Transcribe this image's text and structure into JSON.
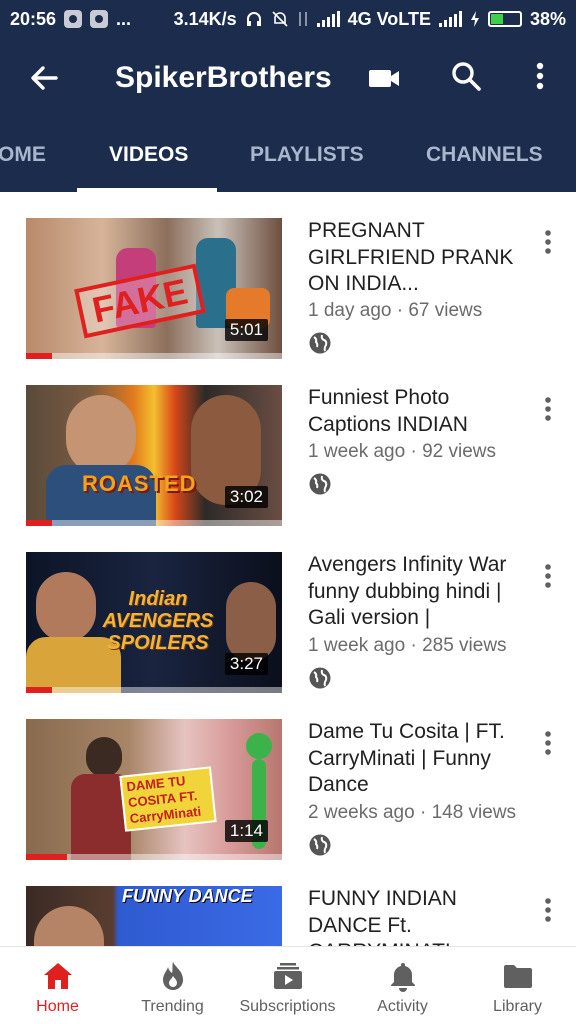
{
  "status_bar": {
    "time": "20:56",
    "dots": "...",
    "speed": "3.14K/s",
    "network": "4G VoLTE",
    "battery": "38%"
  },
  "appbar": {
    "title": "SpikerBrothers",
    "back_icon": "back-arrow-icon",
    "camera_icon": "video-camera-icon",
    "search_icon": "search-icon",
    "more_icon": "more-vert-icon"
  },
  "tabs": [
    {
      "label": "OME",
      "active": false
    },
    {
      "label": "VIDEOS",
      "active": true
    },
    {
      "label": "PLAYLISTS",
      "active": false
    },
    {
      "label": "CHANNELS",
      "active": false
    }
  ],
  "videos": [
    {
      "title": "PREGNANT GIRLFRIEND PRANK ON INDIA...",
      "meta": "1 day ago · 67 views",
      "duration": "5:01",
      "overlay": "FAKE",
      "watched_fraction": 0.1
    },
    {
      "title": "Funniest Photo Captions INDIAN",
      "meta": "1 week ago · 92 views",
      "duration": "3:02",
      "overlay": "ROASTED",
      "watched_fraction": 0.1
    },
    {
      "title": "Avengers Infinity War funny dubbing hindi | Gali version |",
      "meta": "1 week ago · 285 views",
      "duration": "3:27",
      "overlay": "Indian AVENGERS SPOILERS",
      "watched_fraction": 0.1
    },
    {
      "title": "Dame Tu Cosita | FT. CarryMinati | Funny Dance",
      "meta": "2 weeks ago · 148 views",
      "duration": "1:14",
      "overlay": "DAME TU COSITA FT. CarryMinati",
      "watched_fraction": 0.16
    },
    {
      "title": "FUNNY INDIAN DANCE Ft. CARRYMINATI",
      "meta": "",
      "duration": "",
      "overlay": "FUNNY DANCE",
      "watched_fraction": 0
    }
  ],
  "bottom_nav": [
    {
      "label": "Home",
      "icon": "home-icon",
      "active": true
    },
    {
      "label": "Trending",
      "icon": "flame-icon",
      "active": false
    },
    {
      "label": "Subscriptions",
      "icon": "subscriptions-icon",
      "active": false
    },
    {
      "label": "Activity",
      "icon": "bell-icon",
      "active": false
    },
    {
      "label": "Library",
      "icon": "folder-icon",
      "active": false
    }
  ],
  "colors": {
    "header": "#1c2c4d",
    "accent": "#e01f1f",
    "tab_inactive": "#a9b6cc"
  }
}
